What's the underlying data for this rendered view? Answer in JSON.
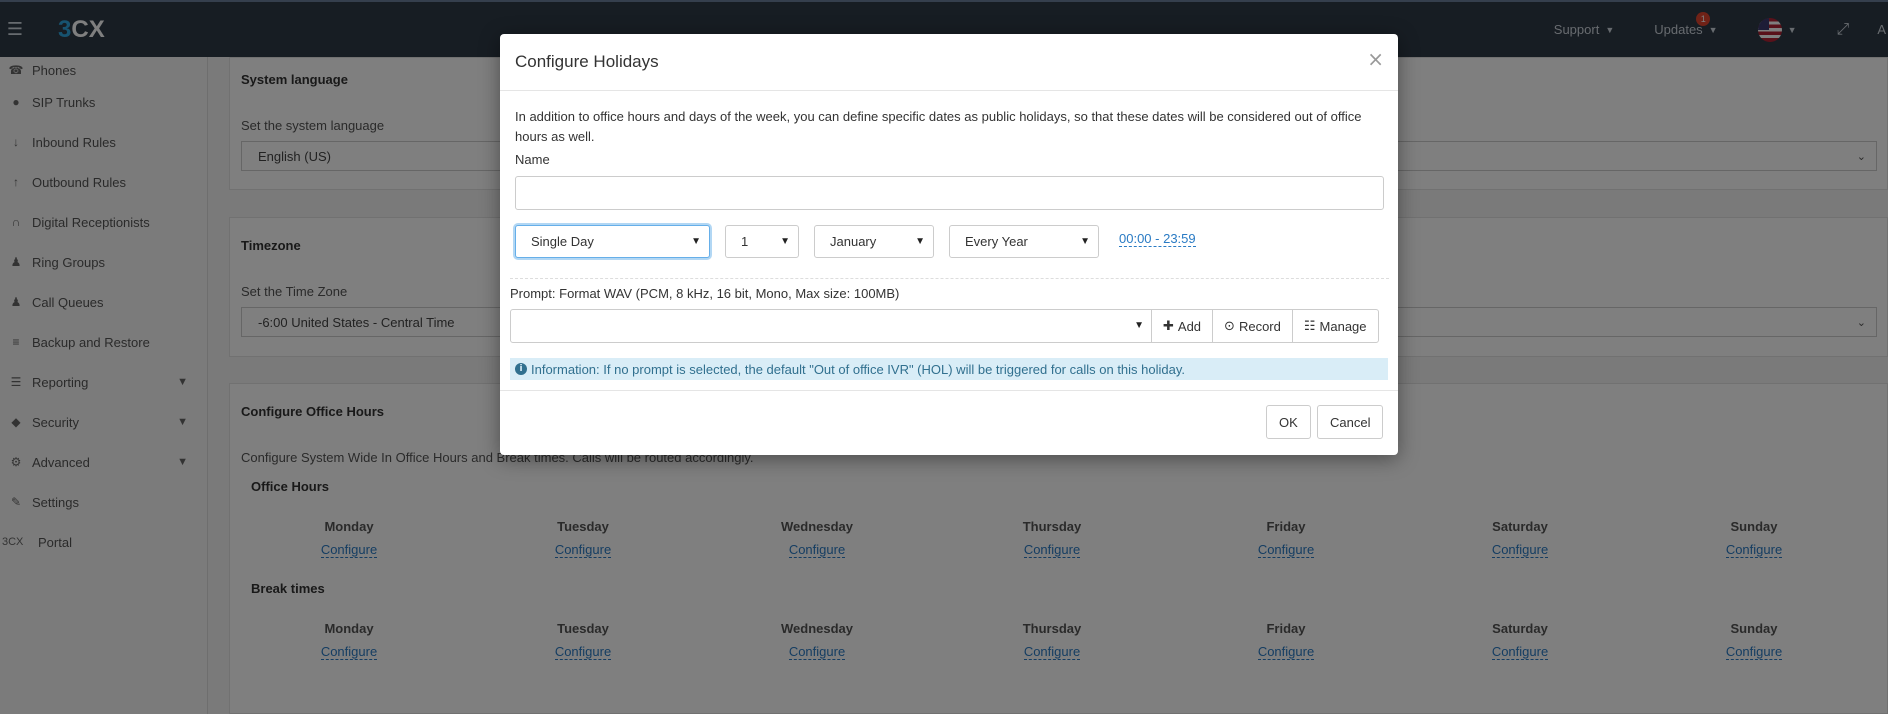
{
  "topbar": {
    "logo_pre": "3",
    "logo_post": "CX",
    "support_label": "Support",
    "updates_label": "Updates",
    "updates_badge": "1",
    "user_initial": "A"
  },
  "sidebar": {
    "items": [
      {
        "label": "Phones",
        "icon": "phone-icon"
      },
      {
        "label": "SIP Trunks",
        "icon": "globe-icon"
      },
      {
        "label": "Inbound Rules",
        "icon": "arrow-down-icon"
      },
      {
        "label": "Outbound Rules",
        "icon": "arrow-up-icon"
      },
      {
        "label": "Digital Receptionists",
        "icon": "headset-icon"
      },
      {
        "label": "Ring Groups",
        "icon": "users-icon"
      },
      {
        "label": "Call Queues",
        "icon": "users-icon"
      },
      {
        "label": "Backup and Restore",
        "icon": "database-icon"
      },
      {
        "label": "Reporting",
        "icon": "list-icon"
      },
      {
        "label": "Security",
        "icon": "shield-icon"
      },
      {
        "label": "Advanced",
        "icon": "gear-icon"
      },
      {
        "label": "Settings",
        "icon": "wrench-icon"
      },
      {
        "label": "Portal",
        "icon": "3cx-icon",
        "prefix": "3CX"
      }
    ]
  },
  "main": {
    "system_language": {
      "title": "System language",
      "subtitle": "Set the system language",
      "value": "English (US)"
    },
    "timezone": {
      "title": "Timezone",
      "subtitle": "Set the Time Zone",
      "value": "-6:00 United States - Central Time"
    },
    "office_hours": {
      "title": "Configure Office Hours",
      "subtitle": "Configure System Wide In Office Hours and Break times. Calls will be routed accordingly.",
      "office_hours_label": "Office Hours",
      "break_times_label": "Break times",
      "days": [
        "Monday",
        "Tuesday",
        "Wednesday",
        "Thursday",
        "Friday",
        "Saturday",
        "Sunday"
      ],
      "configure_label": "Configure"
    }
  },
  "modal": {
    "title": "Configure Holidays",
    "close": "×",
    "description": "In addition to office hours and days of the week, you can define specific dates as public holidays, so that these dates will be considered out of office hours as well.",
    "name_label": "Name",
    "name_value": "",
    "type_value": "Single Day",
    "day_value": "1",
    "month_value": "January",
    "repeat_value": "Every Year",
    "time_range": "00:00 - 23:59",
    "prompt_label": "Prompt: Format WAV (PCM, 8 kHz, 16 bit, Mono, Max size: 100MB)",
    "prompt_value": "",
    "add_label": "Add",
    "record_label": "Record",
    "manage_label": "Manage",
    "info_text": "Information: If no prompt is selected, the default \"Out of office IVR\" (HOL) will be triggered for calls on this holiday.",
    "ok_label": "OK",
    "cancel_label": "Cancel"
  }
}
